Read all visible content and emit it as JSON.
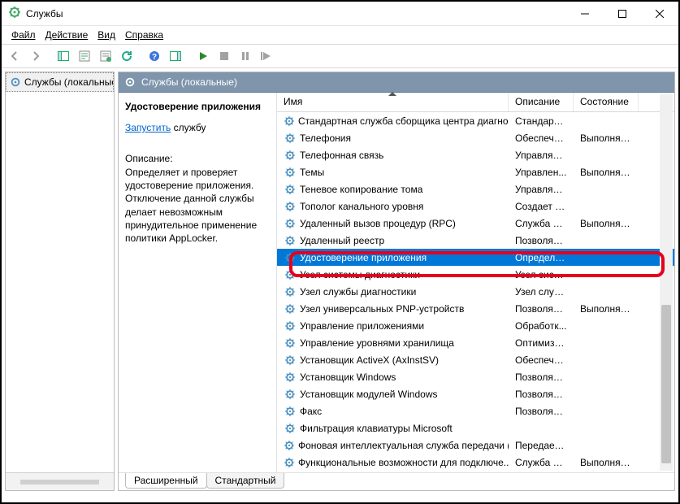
{
  "window": {
    "title": "Службы"
  },
  "menu": {
    "file": "Файл",
    "action": "Действие",
    "view": "Вид",
    "help": "Справка"
  },
  "tree": {
    "item": "Службы (локальные)"
  },
  "panel": {
    "header": "Службы (локальные)",
    "selected_name": "Удостоверение приложения",
    "start_link": "Запустить",
    "start_suffix": " службу",
    "desc_label": "Описание:",
    "desc": "Определяет и проверяет удостоверение приложения. Отключение данной службы делает невозможным принудительное применение политики AppLocker."
  },
  "columns": {
    "name": "Имя",
    "desc": "Описание",
    "state": "Состояние"
  },
  "tabs": {
    "ext": "Расширенный",
    "std": "Стандартный"
  },
  "services": [
    {
      "name": "Стандартная служба сборщика центра диагно...",
      "desc": "Стандартн...",
      "state": ""
    },
    {
      "name": "Телефония",
      "desc": "Обеспечи...",
      "state": "Выполняетс"
    },
    {
      "name": "Телефонная связь",
      "desc": "Управляет...",
      "state": ""
    },
    {
      "name": "Темы",
      "desc": "Управлен...",
      "state": "Выполняетс"
    },
    {
      "name": "Теневое копирование тома",
      "desc": "Управляет...",
      "state": ""
    },
    {
      "name": "Тополог канального уровня",
      "desc": "Создает ка...",
      "state": ""
    },
    {
      "name": "Удаленный вызов процедур (RPC)",
      "desc": "Служба R...",
      "state": "Выполняетс"
    },
    {
      "name": "Удаленный реестр",
      "desc": "Позволяет...",
      "state": ""
    },
    {
      "name": "Удостоверение приложения",
      "desc": "Определя...",
      "state": "",
      "selected": true
    },
    {
      "name": "Узел системы диагностики",
      "desc": "Узел систе...",
      "state": ""
    },
    {
      "name": "Узел службы диагностики",
      "desc": "Узел служ...",
      "state": ""
    },
    {
      "name": "Узел универсальных PNP-устройств",
      "desc": "Позволяет...",
      "state": "Выполняетс"
    },
    {
      "name": "Управление приложениями",
      "desc": "Обработк...",
      "state": ""
    },
    {
      "name": "Управление уровнями хранилища",
      "desc": "Оптимизи...",
      "state": ""
    },
    {
      "name": "Установщик ActiveX (AxInstSV)",
      "desc": "Обеспечи...",
      "state": ""
    },
    {
      "name": "Установщик Windows",
      "desc": "Позволяет...",
      "state": ""
    },
    {
      "name": "Установщик модулей Windows",
      "desc": "Позволяет...",
      "state": ""
    },
    {
      "name": "Факс",
      "desc": "Позволяет...",
      "state": ""
    },
    {
      "name": "Фильтрация клавиатуры Microsoft",
      "desc": "",
      "state": ""
    },
    {
      "name": "Фоновая интеллектуальная служба передачи (...",
      "desc": "Передает ...",
      "state": ""
    },
    {
      "name": "Функциональные возможности для подключе...",
      "desc": "Служба ф...",
      "state": "Выполняетс"
    }
  ]
}
